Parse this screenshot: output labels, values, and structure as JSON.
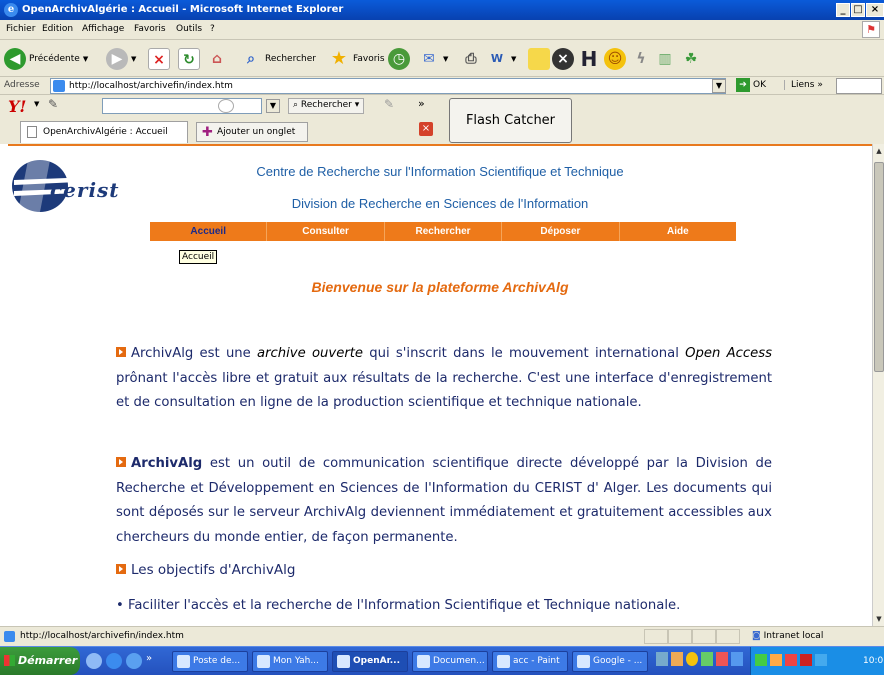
{
  "window": {
    "title": "OpenArchivAlgérie : Accueil - Microsoft Internet Explorer"
  },
  "menu": [
    "Fichier",
    "Edition",
    "Affichage",
    "Favoris",
    "Outils",
    "?"
  ],
  "toolbar": {
    "back_label": "Précédente",
    "search_label": "Rechercher",
    "favorites_label": "Favoris"
  },
  "address": {
    "label": "Adresse",
    "url": "http://localhost/archivefin/index.htm",
    "go_label": "OK",
    "links_label": "Liens"
  },
  "yahoo": {
    "search_label": "Rechercher",
    "more": "»"
  },
  "flash_catcher": "Flash Catcher",
  "tabs": {
    "active_label": "OpenArchivAlgérie : Accueil",
    "add_label": "Ajouter un onglet"
  },
  "page": {
    "logo_text": "cerist",
    "header_line1": "Centre de Recherche sur l'Information Scientifique et Technique",
    "header_line2": "Division de Recherche en Sciences de l'Information",
    "nav": [
      "Accueil",
      "Consulter",
      "Rechercher",
      "Déposer",
      "Aide"
    ],
    "tooltip": "Accueil",
    "welcome": "Bienvenue sur la plateforme ArchivAlg",
    "p1": {
      "name": "ArchivAlg",
      "a": " est une ",
      "em": "archive ouverte",
      "b": " qui s'inscrit dans le mouvement international ",
      "oa": "Open Access",
      "c": " prônant l'accès libre et gratuit aux résultats de la recherche. C'est une interface d'enregistrement et de consultation en ligne de la production scientifique et technique nationale."
    },
    "p2": {
      "name": "ArchivAlg",
      "rest": " est un outil de communication scientifique directe développé par la Division de Recherche et Développement en Sciences de l'Information du CERIST d' Alger. Les documents qui sont déposés sur le serveur ArchivAlg deviennent immédiatement et gratuitement accessibles aux chercheurs du monde entier, de façon permanente."
    },
    "objectifs_heading": "Les objectifs d'ArchivAlg",
    "objectif1": "• Faciliter l'accès et la recherche de l'Information Scientifique et Technique nationale."
  },
  "status": {
    "url": "http://localhost/archivefin/index.htm",
    "zone": "Intranet local"
  },
  "taskbar": {
    "start": "Démarrer",
    "more": "»",
    "tasks": [
      "Poste de...",
      "Mon Yah...",
      "OpenAr...",
      "Documen...",
      "acc - Paint",
      "Google - ..."
    ],
    "clock": "10:0"
  },
  "colors": {
    "accent": "#ee7a1a",
    "text_blue": "#1d2a6b",
    "header_blue": "#1f5fa6"
  }
}
